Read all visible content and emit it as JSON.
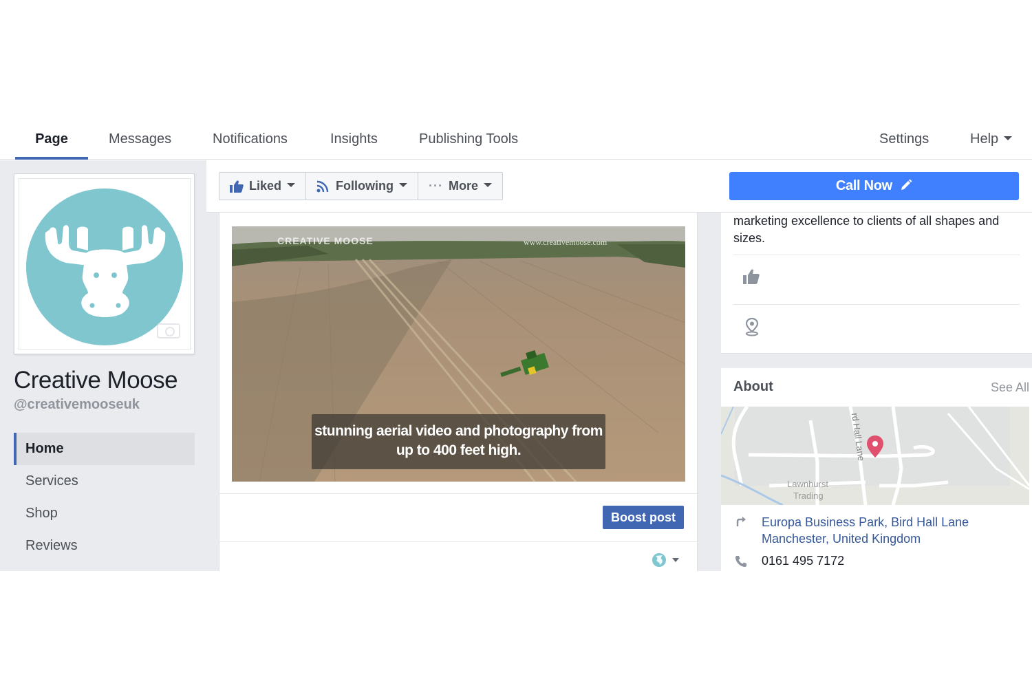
{
  "nav": {
    "tabs": [
      {
        "label": "Page",
        "active": true
      },
      {
        "label": "Messages"
      },
      {
        "label": "Notifications"
      },
      {
        "label": "Insights"
      },
      {
        "label": "Publishing Tools"
      }
    ],
    "settings_label": "Settings",
    "help_label": "Help"
  },
  "profile": {
    "name": "Creative Moose",
    "handle": "@creativemooseuk",
    "avatar_color": "#7fc6cf"
  },
  "sidebar": {
    "items": [
      {
        "label": "Home",
        "active": true
      },
      {
        "label": "Services"
      },
      {
        "label": "Shop"
      },
      {
        "label": "Reviews"
      }
    ]
  },
  "actions": {
    "liked_label": "Liked",
    "following_label": "Following",
    "more_label": "More",
    "call_now_label": "Call Now",
    "call_now_color": "#4080ff"
  },
  "post": {
    "video_watermark_name": "CREATIVE MOOSE",
    "video_watermark_url": "www.creativemoose.com",
    "caption_line1": "stunning aerial video and photography from",
    "caption_line2": "up to 400 feet high.",
    "boost_label": "Boost post"
  },
  "info": {
    "description": "marketing excellence to clients of all shapes and sizes.",
    "row_icons": [
      "thumbs-up-icon",
      "location-pin-icon"
    ]
  },
  "about": {
    "title": "About",
    "see_all_label": "See All",
    "map_labels": {
      "road": "Bird Hall Lane",
      "road_visible": "rd Hall Lane",
      "area_line1": "Lawnhurst",
      "area_line2": "Trading"
    },
    "address_line1": "Europa Business Park, Bird Hall Lane",
    "address_line2": "Manchester, United Kingdom",
    "phone": "0161 495 7172"
  }
}
